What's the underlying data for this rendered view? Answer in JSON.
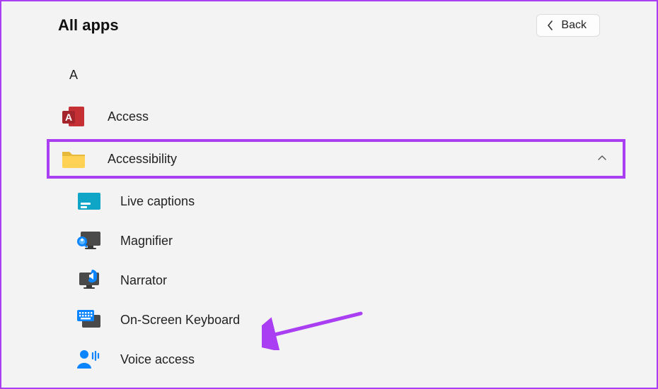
{
  "header": {
    "title": "All apps",
    "back_label": "Back"
  },
  "section_letter": "A",
  "apps": {
    "access": {
      "label": "Access"
    },
    "accessibility": {
      "label": "Accessibility"
    }
  },
  "accessibility_children": {
    "live_captions": {
      "label": "Live captions"
    },
    "magnifier": {
      "label": "Magnifier"
    },
    "narrator": {
      "label": "Narrator"
    },
    "osk": {
      "label": "On-Screen Keyboard"
    },
    "voice_access": {
      "label": "Voice access"
    }
  },
  "annotation": {
    "highlight_color": "#a93ef2",
    "arrow_target": "On-Screen Keyboard"
  }
}
